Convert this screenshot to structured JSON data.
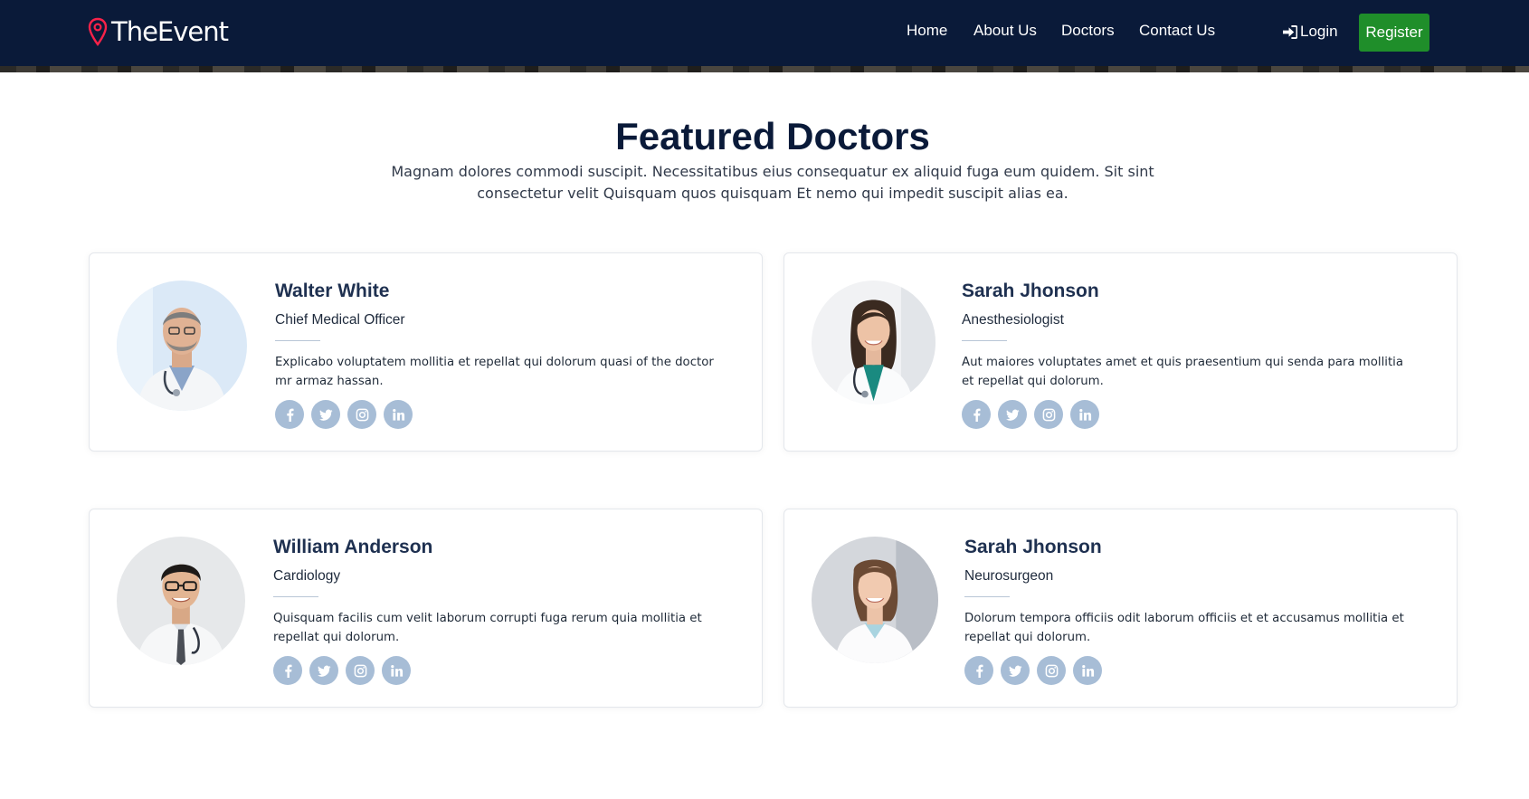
{
  "header": {
    "brand": "TheEvent",
    "nav": [
      {
        "label": "Home"
      },
      {
        "label": "About Us"
      },
      {
        "label": "Doctors"
      },
      {
        "label": "Contact Us"
      }
    ],
    "login_label": "Login",
    "register_label": "Register"
  },
  "section": {
    "title": "Featured Doctors",
    "subtitle": "Magnam dolores commodi suscipit. Necessitatibus eius consequatur ex aliquid fuga eum quidem. Sit sint consectetur velit Quisquam quos quisquam Et nemo qui impedit suscipit alias ea."
  },
  "doctors": [
    {
      "name": "Walter White",
      "role": "Chief Medical Officer",
      "description": "Explicabo voluptatem mollitia et repellat qui dolorum quasi of the doctor mr armaz hassan."
    },
    {
      "name": "Sarah Jhonson",
      "role": "Anesthesiologist",
      "description": "Aut maiores voluptates amet et quis praesentium qui senda para mollitia et repellat qui dolorum."
    },
    {
      "name": "William Anderson",
      "role": "Cardiology",
      "description": "Quisquam facilis cum velit laborum corrupti fuga rerum quia mollitia et repellat qui dolorum."
    },
    {
      "name": "Sarah Jhonson",
      "role": "Neurosurgeon",
      "description": "Dolorum tempora officiis odit laborum officiis et et accusamus mollitia et repellat qui dolorum."
    }
  ],
  "colors": {
    "header_bg": "#0a1a39",
    "brand_pin": "#f82249",
    "register_bg": "#1f8e2a",
    "social_bg": "#a7bdd6",
    "name_color": "#1e3050"
  },
  "icons": [
    "map-pin-icon",
    "sign-in-icon",
    "facebook-icon",
    "twitter-icon",
    "instagram-icon",
    "linkedin-icon"
  ]
}
